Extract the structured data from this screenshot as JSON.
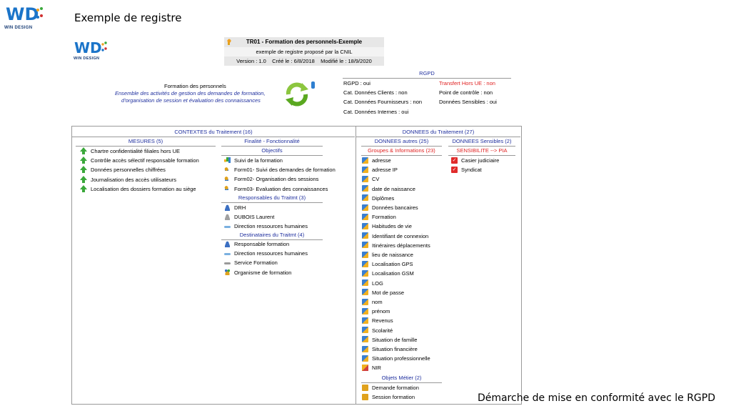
{
  "slide": {
    "title": "Exemple de registre",
    "footer": "Démarche de mise en conformité avec le RGPD"
  },
  "logo": {
    "mark": "WD",
    "brand": "WIN DESIGN"
  },
  "treatment": {
    "title": "TR01 - Formation des personnels-Exemple",
    "subtitle": "exemple de registre proposé par la CNIL",
    "version": "Version : 1.0",
    "created": "Créé le : 6/8/2018",
    "modified": "Modifié le : 18/9/2020",
    "name": "Formation des personnels",
    "description_1": "Ensemble des activités de gestion des demandes de formation,",
    "description_2": "d'organisation de session et évaluation des connaissances"
  },
  "rgpd": {
    "header": "RGPD",
    "left": [
      "RGPD : oui",
      "Cat. Données Clients : non",
      "Cat. Données Fournisseurs : non",
      "Cat. Données Internes : oui"
    ],
    "right": [
      {
        "text": "Transfert Hors UE : non",
        "highlight": true
      },
      {
        "text": "Point de contrôle : non",
        "highlight": false
      },
      {
        "text": "Données Sensibles : oui",
        "highlight": false
      }
    ]
  },
  "contextes": {
    "header": "CONTEXTES du Traitement (16)",
    "mesures": {
      "header": "MESURES (5)",
      "items": [
        "Chartre confidentialité filiales hors UE",
        "Contrôle accès sélectif responsable formation",
        "Données personnelles chiffrées",
        "Journalisation des accès utilisateurs",
        "Localisation des dossiers formation au siège"
      ]
    },
    "finalite": {
      "header": "Finalité - Fonctionnalité",
      "objectifs_header": "Objectifs",
      "objectifs": [
        {
          "label": "Suivi de la formation",
          "icon": "chart-icon"
        },
        {
          "label": "Form01- Suivi des demandes de formation",
          "icon": "key-icon"
        },
        {
          "label": "Form02- Organisation des sessions",
          "icon": "key-icon"
        },
        {
          "label": "Form03- Evaluation des connaissances",
          "icon": "key-icon"
        }
      ],
      "responsables_header": "Responsables du Traitmt (3)",
      "responsables": [
        {
          "label": "DRH",
          "icon": "person-icon"
        },
        {
          "label": "DUBOIS Laurent",
          "icon": "person-grey-icon"
        },
        {
          "label": "Direction ressources humaines",
          "icon": "department-icon"
        }
      ],
      "destinataires_header": "Destinataires du Traitmt (4)",
      "destinataires": [
        {
          "label": "Responsable formation",
          "icon": "person-icon"
        },
        {
          "label": "Direction ressources humaines",
          "icon": "department-icon"
        },
        {
          "label": "Service Formation",
          "icon": "department-grey-icon"
        },
        {
          "label": "Organisme de formation",
          "icon": "group-icon"
        }
      ]
    }
  },
  "donnees": {
    "header": "DONNEES du Traitement (27)",
    "autres": {
      "header": "DONNEES autres (25)",
      "groupes_header": "Groupes & Informations (23)",
      "items": [
        "adresse",
        "adresse IP",
        "CV",
        "date de naissance",
        "Diplômes",
        "Données bancaires",
        "Formation",
        "Habitudes de vie",
        "Identifiant de connexion",
        "Itinéraires déplacements",
        "lieu de naissance",
        "Localisation GPS",
        "Localisation GSM",
        "LOG",
        "Mot de passe",
        "nom",
        "prénom",
        "Revenus",
        "Scolarité",
        "Situation de famille",
        "Situation financière",
        "Situation professionnelle",
        "NIR"
      ],
      "objets_header": "Objets Métier (2)",
      "objets": [
        "Demande formation",
        "Session formation"
      ]
    },
    "sensibles": {
      "header": "DONNEES Sensibles (2)",
      "sensibilite_header": "SENSIBILITE --> PIA",
      "items": [
        "Casier judiciaire",
        "Syndicat"
      ]
    }
  }
}
